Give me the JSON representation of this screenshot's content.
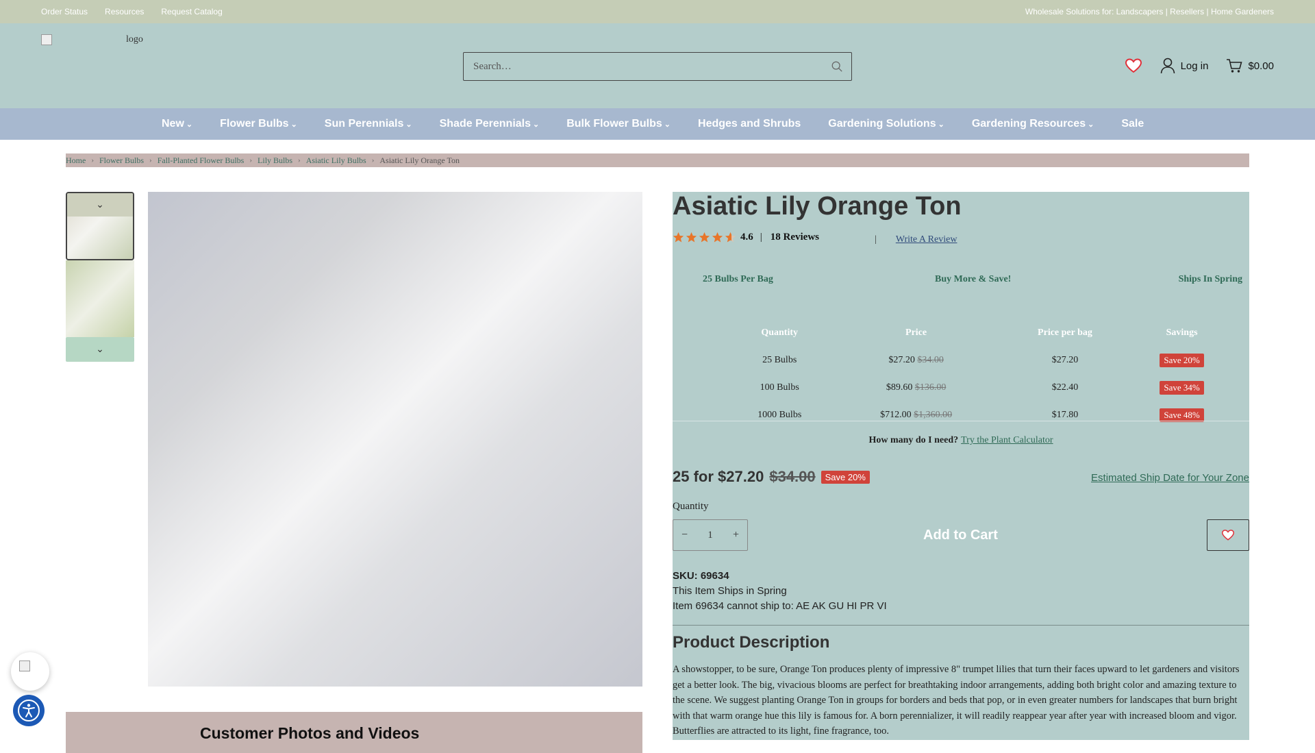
{
  "topbar": {
    "links": [
      "Order Status",
      "Resources",
      "Request Catalog"
    ],
    "tagline": "Wholesale Solutions for: Landscapers | Resellers | Home Gardeners"
  },
  "header": {
    "logo_alt": "logo",
    "search_placeholder": "Search…",
    "login_label": "Log in",
    "cart_total": "$0.00"
  },
  "nav": {
    "items": [
      "New",
      "Flower Bulbs",
      "Sun Perennials",
      "Shade Perennials",
      "Bulk Flower Bulbs",
      "Hedges and Shrubs",
      "Gardening Solutions",
      "Gardening Resources",
      "Sale"
    ]
  },
  "breadcrumb": [
    "Home",
    "Flower Bulbs",
    "Fall-Planted Flower Bulbs",
    "Lily Bulbs",
    "Asiatic Lily Bulbs",
    "Asiatic Lily Orange Ton"
  ],
  "product": {
    "title": "Asiatic Lily Orange Ton",
    "rating": "4.6",
    "rating_value": 4.6,
    "reviews": "18 Reviews",
    "write_review_sep": "|",
    "write_review": "Write A Review",
    "features": [
      "25 Bulbs Per Bag",
      "Buy More & Save!",
      "Ships In Spring"
    ],
    "tier_headers": [
      "Quantity",
      "Price",
      "Price per bag",
      "Savings"
    ],
    "tiers": [
      {
        "qty": "25 Bulbs",
        "price": "$27.20",
        "was": "$34.00",
        "per_bag": "$27.20",
        "save": "Save 20%"
      },
      {
        "qty": "100 Bulbs",
        "price": "$89.60",
        "was": "$136.00",
        "per_bag": "$22.40",
        "save": "Save 34%"
      },
      {
        "qty": "1000 Bulbs",
        "price": "$712.00",
        "was": "$1,360.00",
        "per_bag": "$17.80",
        "save": "Save 48%"
      }
    ],
    "calc_question": "How many do I need?",
    "calc_link": "Try the Plant Calculator",
    "price_prefix": "25 for",
    "price": "$27.20",
    "was_price": "$34.00",
    "price_save": "Save 20%",
    "ship_zone_link": "Estimated Ship Date for Your Zone",
    "quantity_label": "Quantity",
    "quantity": "1",
    "add_to_cart": "Add to Cart",
    "sku": "SKU: 69634",
    "ships_note": "This Item Ships in Spring",
    "restriction": "Item 69634 cannot ship to: AE AK GU HI PR VI",
    "description_heading": "Product Description",
    "description": "A showstopper, to be sure, Orange Ton produces plenty of impressive 8\" trumpet lilies that turn their faces upward to let gardeners and visitors get a better look. The big, vivacious blooms are perfect for breathtaking indoor arrangements, adding both bright color and amazing texture to the scene. We suggest planting Orange Ton in groups for borders and beds that pop, or in even greater numbers for landscapes that burn bright with that warm orange hue this lily is famous for. A born perennializer, it will readily reappear year after year with increased bloom and vigor. Butterflies are attracted to its light, fine fragrance, too."
  },
  "ugc_heading": "Customer Photos and Videos",
  "colors": {
    "header_bg": "#b4cdcb",
    "topbar_bg": "#c5cdb6",
    "nav_bg": "#a7b8cf",
    "breadcrumb_bg": "#c6b4b1",
    "badge": "#d0433a",
    "star": "#e8752a"
  }
}
